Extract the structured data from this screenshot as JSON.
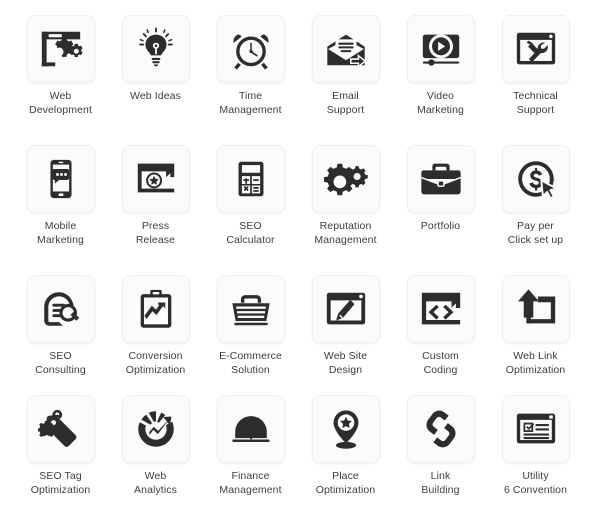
{
  "theme": {
    "background": "#ffffff",
    "tile_background": "#fbfbfb",
    "tile_border": "#f0f0f0",
    "icon_color": "#2d2d2d",
    "label_color": "#3e3e3e"
  },
  "grid": {
    "columns": 6,
    "rows": 4,
    "total_icons": 24
  },
  "icons": [
    {
      "icon": "browser-gears-icon",
      "label": "Web\nDevelopment"
    },
    {
      "icon": "lightbulb-idea-icon",
      "label": "Web Ideas"
    },
    {
      "icon": "alarm-clock-icon",
      "label": "Time\nManagement"
    },
    {
      "icon": "open-envelope-arrow-icon",
      "label": "Email\nSupport"
    },
    {
      "icon": "video-player-play-icon",
      "label": "Video\nMarketing"
    },
    {
      "icon": "browser-tools-icon",
      "label": "Technical\nSupport"
    },
    {
      "icon": "smartphone-chat-icon",
      "label": "Mobile\nMarketing"
    },
    {
      "icon": "browser-star-icon",
      "label": "Press\nRelease"
    },
    {
      "icon": "calculator-icon",
      "label": "SEO\nCalculator"
    },
    {
      "icon": "two-gears-icon",
      "label": "Reputation\nManagement"
    },
    {
      "icon": "briefcase-icon",
      "label": "Portfolio"
    },
    {
      "icon": "dollar-coin-cursor-icon",
      "label": "Pay per\nClick set up"
    },
    {
      "icon": "seo-magnifier-icon",
      "label": "SEO\nConsulting"
    },
    {
      "icon": "clipboard-chart-icon",
      "label": "Conversion\nOptimization"
    },
    {
      "icon": "shopping-basket-icon",
      "label": "E-Commerce\nSolution"
    },
    {
      "icon": "browser-pencil-icon",
      "label": "Web Site\nDesign"
    },
    {
      "icon": "browser-code-icon",
      "label": "Custom\nCoding"
    },
    {
      "icon": "browser-upload-arrow-icon",
      "label": "Web Link\nOptimization"
    },
    {
      "icon": "tag-gear-icon",
      "label": "SEO Tag\nOptimization"
    },
    {
      "icon": "pie-chart-arrow-icon",
      "label": "Web\nAnalytics"
    },
    {
      "icon": "finance-gauge-icon",
      "label": "Finance\nManagement"
    },
    {
      "icon": "map-pin-star-icon",
      "label": "Place\nOptimization"
    },
    {
      "icon": "chain-link-icon",
      "label": "Link\nBuilding"
    },
    {
      "icon": "checklist-document-icon",
      "label": "Utility\n6 Convention"
    }
  ]
}
